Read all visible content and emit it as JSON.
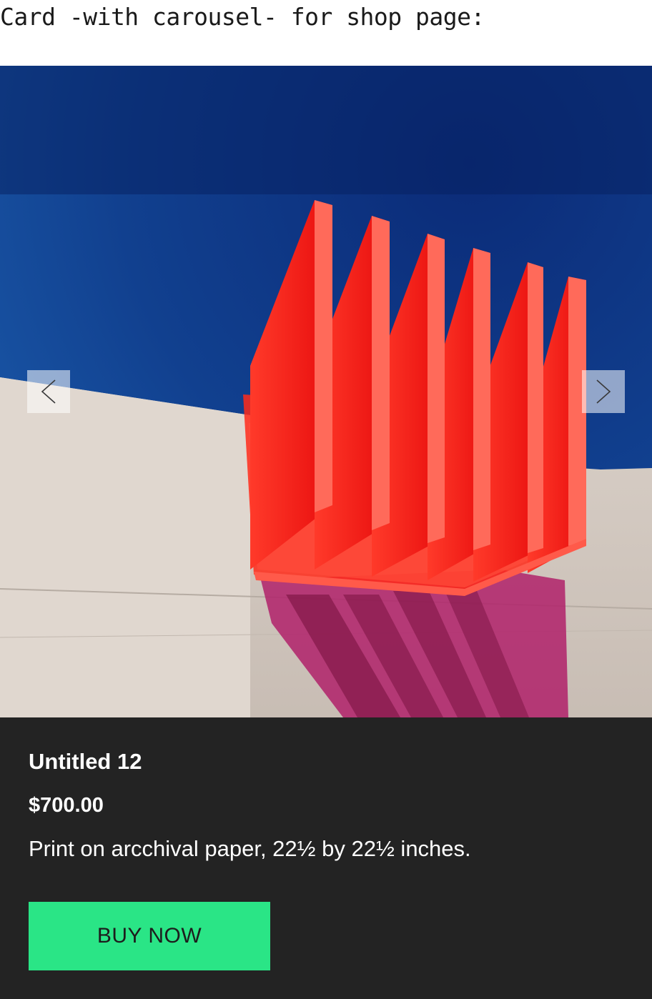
{
  "page": {
    "heading": "Card -with carousel- for shop page:"
  },
  "carousel": {
    "image_subject": "red acrylic sculpture on concrete wall against blue sky",
    "prev_icon": "chevron-left-icon",
    "next_icon": "chevron-right-icon"
  },
  "product": {
    "title": "Untitled 12",
    "price": "$700.00",
    "description": "Print on arcchival paper, 22½ by 22½ inches.",
    "buy_label": "BUY NOW"
  },
  "colors": {
    "info_background": "#232323",
    "buy_button": "#2ae586",
    "sky": "#0a2a6e",
    "sculpture": "#ff1a1a"
  }
}
